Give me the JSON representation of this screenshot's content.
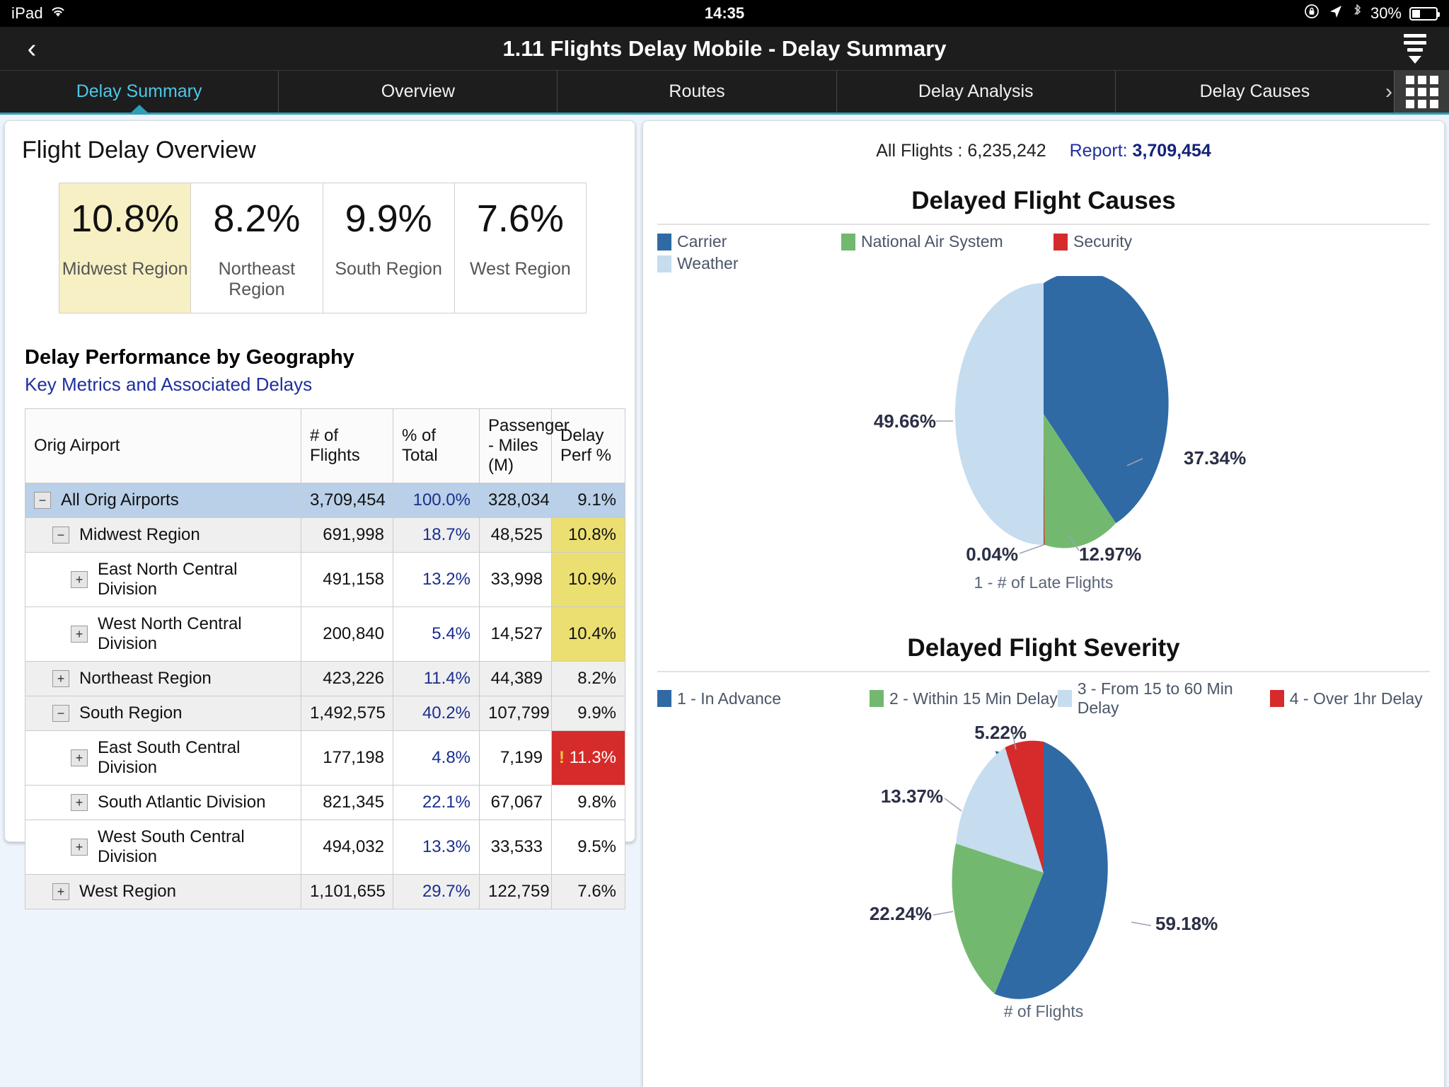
{
  "status_bar": {
    "device": "iPad",
    "wifi_icon": "wifi-icon",
    "time": "14:35",
    "rotation_lock_icon": "rotation-lock-icon",
    "location_icon": "location-arrow-icon",
    "bluetooth_icon": "bluetooth-icon",
    "battery_pct": "30%"
  },
  "titlebar": {
    "back_icon": "chevron-left-icon",
    "title": "1.11 Flights Delay Mobile - Delay Summary",
    "menu_icon": "filter-menu-icon"
  },
  "tabs": [
    {
      "label": "Delay Summary",
      "active": true
    },
    {
      "label": "Overview",
      "active": false
    },
    {
      "label": "Routes",
      "active": false
    },
    {
      "label": "Delay Analysis",
      "active": false
    },
    {
      "label": "Delay Causes",
      "active": false
    }
  ],
  "tab_overflow_icon": "chevron-right-icon",
  "grid_button_icon": "grid-apps-icon",
  "left_panel": {
    "heading": "Flight Delay Overview",
    "kpis": [
      {
        "value": "10.8%",
        "label": "Midwest Region",
        "highlighted": true
      },
      {
        "value": "8.2%",
        "label": "Northeast Region",
        "highlighted": false
      },
      {
        "value": "9.9%",
        "label": "South Region",
        "highlighted": false
      },
      {
        "value": "7.6%",
        "label": "West Region",
        "highlighted": false
      }
    ],
    "section_title": "Delay Performance by Geography",
    "section_subtitle": "Key Metrics and Associated Delays",
    "table": {
      "columns": [
        "Orig Airport",
        "# of Flights",
        "% of Total",
        "Passenger - Miles (M)",
        "Delay Perf %"
      ],
      "rows": [
        {
          "name": "All Orig Airports",
          "indent": 1,
          "toggle": "−",
          "flights": "3,709,454",
          "pct_total": "100.0%",
          "pax_miles": "328,034",
          "delay_perf": "9.1%",
          "state": "selected",
          "perf_state": "none"
        },
        {
          "name": "Midwest Region",
          "indent": 2,
          "toggle": "−",
          "flights": "691,998",
          "pct_total": "18.7%",
          "pax_miles": "48,525",
          "delay_perf": "10.8%",
          "state": "even",
          "perf_state": "warn"
        },
        {
          "name": "East North Central Division",
          "indent": 3,
          "toggle": "+",
          "flights": "491,158",
          "pct_total": "13.2%",
          "pax_miles": "33,998",
          "delay_perf": "10.9%",
          "state": "odd",
          "perf_state": "warn"
        },
        {
          "name": "West North Central Division",
          "indent": 3,
          "toggle": "+",
          "flights": "200,840",
          "pct_total": "5.4%",
          "pax_miles": "14,527",
          "delay_perf": "10.4%",
          "state": "odd",
          "perf_state": "warn"
        },
        {
          "name": "Northeast Region",
          "indent": 2,
          "toggle": "+",
          "flights": "423,226",
          "pct_total": "11.4%",
          "pax_miles": "44,389",
          "delay_perf": "8.2%",
          "state": "even",
          "perf_state": "none"
        },
        {
          "name": "South Region",
          "indent": 2,
          "toggle": "−",
          "flights": "1,492,575",
          "pct_total": "40.2%",
          "pax_miles": "107,799",
          "delay_perf": "9.9%",
          "state": "even",
          "perf_state": "none"
        },
        {
          "name": "East South Central Division",
          "indent": 3,
          "toggle": "+",
          "flights": "177,198",
          "pct_total": "4.8%",
          "pax_miles": "7,199",
          "delay_perf": "11.3%",
          "state": "odd",
          "perf_state": "alert"
        },
        {
          "name": "South Atlantic Division",
          "indent": 3,
          "toggle": "+",
          "flights": "821,345",
          "pct_total": "22.1%",
          "pax_miles": "67,067",
          "delay_perf": "9.8%",
          "state": "odd",
          "perf_state": "none"
        },
        {
          "name": "West South Central Division",
          "indent": 3,
          "toggle": "+",
          "flights": "494,032",
          "pct_total": "13.3%",
          "pax_miles": "33,533",
          "delay_perf": "9.5%",
          "state": "odd",
          "perf_state": "none"
        },
        {
          "name": "West Region",
          "indent": 2,
          "toggle": "+",
          "flights": "1,101,655",
          "pct_total": "29.7%",
          "pax_miles": "122,759",
          "delay_perf": "7.6%",
          "state": "even",
          "perf_state": "none"
        }
      ]
    }
  },
  "right_panel": {
    "all_flights_label": "All Flights : 6,235,242",
    "report_label": "Report:",
    "report_value": "3,709,454"
  },
  "colors": {
    "carrier_blue": "#2f6aa5",
    "nas_green": "#72b96f",
    "security_red": "#d62b2b",
    "weather_lightblue": "#c6dcef",
    "accent_teal": "#2e9fb5",
    "link_blue": "#1f2f9f",
    "warn_yellow": "#ebdf72",
    "selected_row": "#b9d0e8"
  },
  "chart_data": [
    {
      "type": "pie",
      "title": "Delayed Flight Causes",
      "caption": "1 - # of Late Flights",
      "legend_position": "top",
      "categories": [
        "Carrier",
        "National Air System",
        "Security",
        "Weather"
      ],
      "values": [
        37.34,
        12.97,
        0.04,
        49.66
      ],
      "labels": [
        "37.34%",
        "12.97%",
        "0.04%",
        "49.66%"
      ],
      "colors": [
        "#2f6aa5",
        "#72b96f",
        "#d62b2b",
        "#c6dcef"
      ],
      "unit": "%"
    },
    {
      "type": "pie",
      "title": "Delayed Flight Severity",
      "caption": "# of Flights",
      "legend_position": "top",
      "categories": [
        "1 - In Advance",
        "2 - Within 15 Min Delay",
        "3 - From 15 to 60 Min Delay",
        "4 - Over 1hr Delay"
      ],
      "values": [
        59.18,
        22.24,
        13.37,
        5.22
      ],
      "labels": [
        "59.18%",
        "22.24%",
        "13.37%",
        "5.22%"
      ],
      "colors": [
        "#2f6aa5",
        "#72b96f",
        "#c6dcef",
        "#d62b2b"
      ],
      "unit": "%"
    }
  ]
}
